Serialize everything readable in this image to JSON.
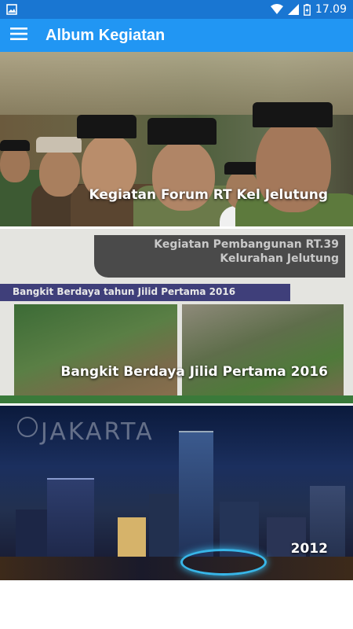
{
  "status_bar": {
    "time": "17.09",
    "icons": [
      "image-notification-icon",
      "wifi-icon",
      "signal-icon",
      "battery-icon"
    ]
  },
  "app_bar": {
    "title": "Album Kegiatan",
    "menu_icon": "hamburger-menu-icon"
  },
  "albums": [
    {
      "caption": "Kegiatan Forum RT Kel Jelutung"
    },
    {
      "caption": "Bangkit Berdaya Jilid Pertama 2016",
      "poster": {
        "title_line1": "Kegiatan Pembangunan RT.39",
        "title_line2": "Kelurahan Jelutung",
        "ribbon": "Bangkit Berdaya tahun Jilid Pertama 2016"
      }
    },
    {
      "caption": "2012",
      "poster": {
        "watermark": "JAKARTA"
      }
    }
  ],
  "colors": {
    "status_bar": "#1976d2",
    "app_bar": "#2196f3",
    "caption_text": "#ffffff"
  }
}
